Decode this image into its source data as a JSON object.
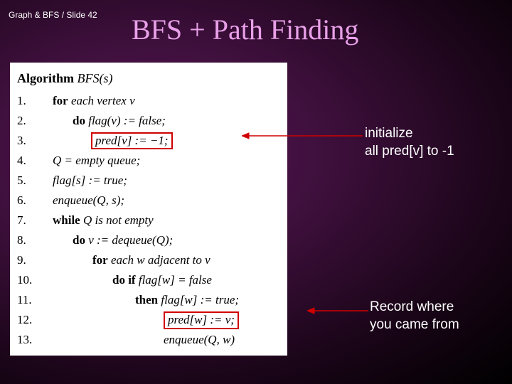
{
  "header": "Graph & BFS / Slide 42",
  "title": "BFS + Path Finding",
  "algorithm": {
    "name_label": "Algorithm",
    "name": "BFS(s)",
    "lines": {
      "l1": {
        "n": "1.",
        "kw": "for",
        "rest": " each vertex v"
      },
      "l2": {
        "n": "2.",
        "kw": "do",
        "rest": " flag(v) := false;"
      },
      "l3": {
        "n": "3.",
        "rest": "pred[v] := −1;"
      },
      "l4": {
        "n": "4.",
        "rest": "Q = empty queue;"
      },
      "l5": {
        "n": "5.",
        "rest": "flag[s] := true;"
      },
      "l6": {
        "n": "6.",
        "rest": "enqueue(Q, s);"
      },
      "l7": {
        "n": "7.",
        "kw": "while",
        "rest": " Q is not empty"
      },
      "l8": {
        "n": "8.",
        "kw": "do",
        "rest": " v := dequeue(Q);"
      },
      "l9": {
        "n": "9.",
        "kw": "for",
        "rest": " each w adjacent to v"
      },
      "l10": {
        "n": "10.",
        "kw": "do if",
        "rest": " flag[w] = false"
      },
      "l11": {
        "n": "11.",
        "kw": "then",
        "rest": " flag[w] := true;"
      },
      "l12": {
        "n": "12.",
        "rest": "pred[w] := v;"
      },
      "l13": {
        "n": "13.",
        "rest": "enqueue(Q, w)"
      }
    }
  },
  "annotations": {
    "a1_line1": "initialize",
    "a1_line2": "all pred[v] to -1",
    "a2_line1": "Record where",
    "a2_line2": "you came from"
  },
  "chart_data": {
    "type": "table",
    "title": "BFS + Path Finding pseudocode",
    "rows": [
      [
        "1",
        "for each vertex v"
      ],
      [
        "2",
        "do flag(v) := false;"
      ],
      [
        "3",
        "pred[v] := -1;"
      ],
      [
        "4",
        "Q = empty queue;"
      ],
      [
        "5",
        "flag[s] := true;"
      ],
      [
        "6",
        "enqueue(Q, s);"
      ],
      [
        "7",
        "while Q is not empty"
      ],
      [
        "8",
        "do v := dequeue(Q);"
      ],
      [
        "9",
        "for each w adjacent to v"
      ],
      [
        "10",
        "do if flag[w] = false"
      ],
      [
        "11",
        "then flag[w] := true;"
      ],
      [
        "12",
        "pred[w] := v;"
      ],
      [
        "13",
        "enqueue(Q, w)"
      ]
    ]
  }
}
